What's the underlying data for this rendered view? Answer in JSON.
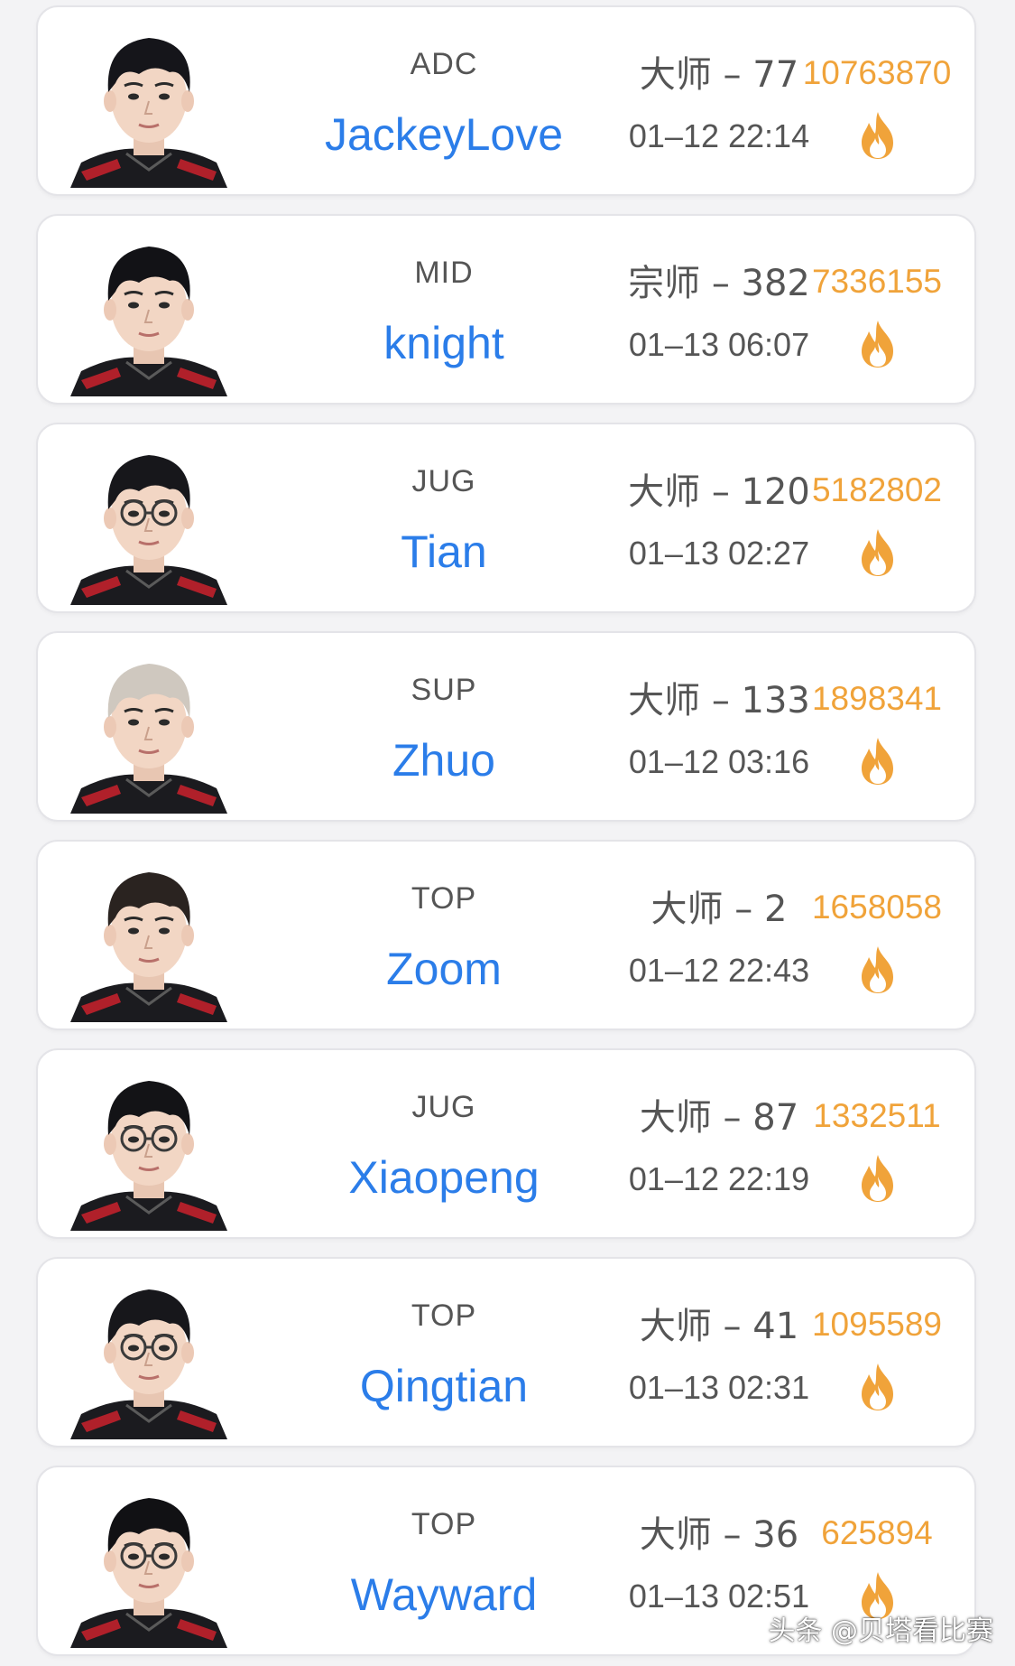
{
  "players": [
    {
      "role": "ADC",
      "name": "JackeyLove",
      "rank": "大师 – 77",
      "time": "01–12 22:14",
      "heat": "10763870",
      "hair": "#15151a",
      "glasses": false
    },
    {
      "role": "MID",
      "name": "knight",
      "rank": "宗师 – 382",
      "time": "01–13 06:07",
      "heat": "7336155",
      "hair": "#121216",
      "glasses": false
    },
    {
      "role": "JUG",
      "name": "Tian",
      "rank": "大师 – 120",
      "time": "01–13 02:27",
      "heat": "5182802",
      "hair": "#17171b",
      "glasses": true
    },
    {
      "role": "SUP",
      "name": "Zhuo",
      "rank": "大师 – 133",
      "time": "01–12 03:16",
      "heat": "1898341",
      "hair": "#cfc8bf",
      "glasses": false
    },
    {
      "role": "TOP",
      "name": "Zoom",
      "rank": "大师 – 2",
      "time": "01–12 22:43",
      "heat": "1658058",
      "hair": "#2a2320",
      "glasses": false
    },
    {
      "role": "JUG",
      "name": "Xiaopeng",
      "rank": "大师 – 87",
      "time": "01–12 22:19",
      "heat": "1332511",
      "hair": "#131316",
      "glasses": true
    },
    {
      "role": "TOP",
      "name": "Qingtian",
      "rank": "大师 – 41",
      "time": "01–13 02:31",
      "heat": "1095589",
      "hair": "#17171b",
      "glasses": true
    },
    {
      "role": "TOP",
      "name": "Wayward",
      "rank": "大师 – 36",
      "time": "01–13 02:51",
      "heat": "625894",
      "hair": "#111114",
      "glasses": true
    }
  ],
  "colors": {
    "name": "#2b7de9",
    "heat": "#f0a33a",
    "text": "#555555",
    "jersey": "#1b1b1f",
    "jersey_stripe": "#b0202a"
  },
  "icons": {
    "heat": "fire-icon",
    "avatar": "player-avatar"
  },
  "watermark": "头条 @贝塔看比赛"
}
